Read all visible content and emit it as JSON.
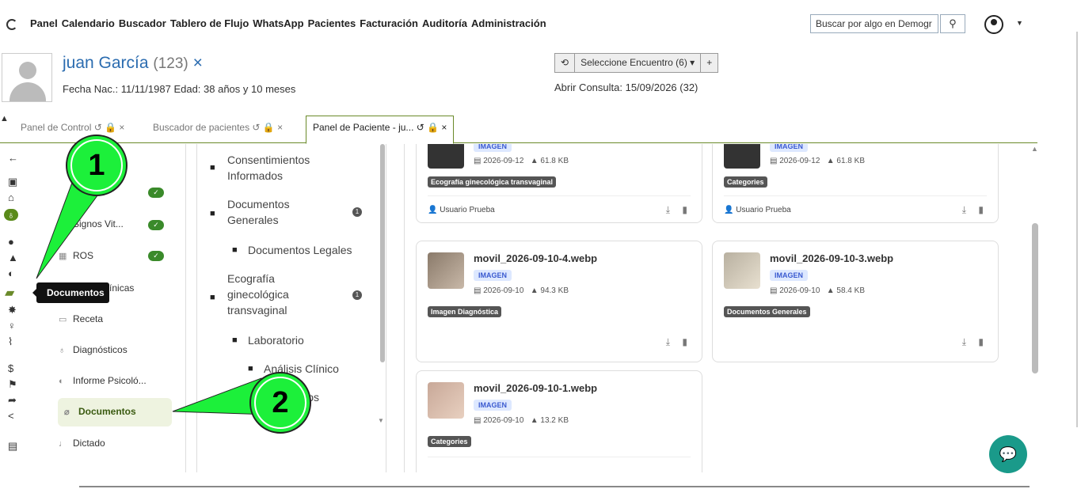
{
  "nav": {
    "menu": [
      "Panel",
      "Calendario",
      "Buscador",
      "Tablero de Flujo",
      "WhatsApp",
      "Pacientes",
      "Facturación",
      "Auditoría",
      "Administración"
    ],
    "search_placeholder": "Buscar por algo en Demogr",
    "search_icon": "search-icon"
  },
  "patient": {
    "name": "juan García",
    "id": "(123)",
    "close": "×",
    "info": "Fecha Nac.: 11/11/1987 Edad: 38 años y 10 meses"
  },
  "encounter": {
    "history_icon": "⟲",
    "select_label": "Seleccione Encuentro",
    "count": "(6)",
    "add": "+",
    "consulta": "Abrir Consulta: 15/09/2026 (32)"
  },
  "tabs": [
    {
      "label": "Panel de Control"
    },
    {
      "label": "Buscador de pacientes"
    },
    {
      "label": "Panel de Paciente - ju..."
    }
  ],
  "tooltip": "Documentos",
  "sidebar": [
    {
      "label": "Signos Vit..."
    },
    {
      "label": "ROS"
    },
    {
      "label": "Notas Clínicas"
    },
    {
      "label": "Receta"
    },
    {
      "label": "Diagnósticos"
    },
    {
      "label": "Informe Psicoló..."
    },
    {
      "label": "Documentos"
    },
    {
      "label": "Dictado"
    }
  ],
  "categories": [
    {
      "label": "Consentimientos Informados"
    },
    {
      "label": "Documentos Generales",
      "badge": "1"
    },
    {
      "label": "Documentos Legales"
    },
    {
      "label": "Ecografía ginecológica transvaginal",
      "badge": "1"
    },
    {
      "label": "Laboratorio"
    },
    {
      "label": "Análisis Clínico"
    },
    {
      "label": "Resultados"
    }
  ],
  "documents": [
    {
      "type": "IMAGEN",
      "date": "2026-09-12",
      "size": "61.8 KB",
      "category": "Ecografía ginecológica transvaginal",
      "author": "Usuario Prueba"
    },
    {
      "type": "IMAGEN",
      "date": "2026-09-12",
      "size": "61.8 KB",
      "category": "Categories",
      "author": "Usuario Prueba"
    },
    {
      "name": "movil_2026-09-10-4.webp",
      "type": "IMAGEN",
      "date": "2026-09-10",
      "size": "94.3 KB",
      "category": "Imagen Diagnóstica"
    },
    {
      "name": "movil_2026-09-10-3.webp",
      "type": "IMAGEN",
      "date": "2026-09-10",
      "size": "58.4 KB",
      "category": "Documentos Generales"
    },
    {
      "name": "movil_2026-09-10-1.webp",
      "type": "IMAGEN",
      "date": "2026-09-10",
      "size": "13.2 KB",
      "category": "Categories"
    }
  ],
  "annotations": [
    "1",
    "2"
  ],
  "colors": {
    "accent": "#6a8a2a",
    "link": "#2b6cb0",
    "annotation": "#1cf03a"
  }
}
